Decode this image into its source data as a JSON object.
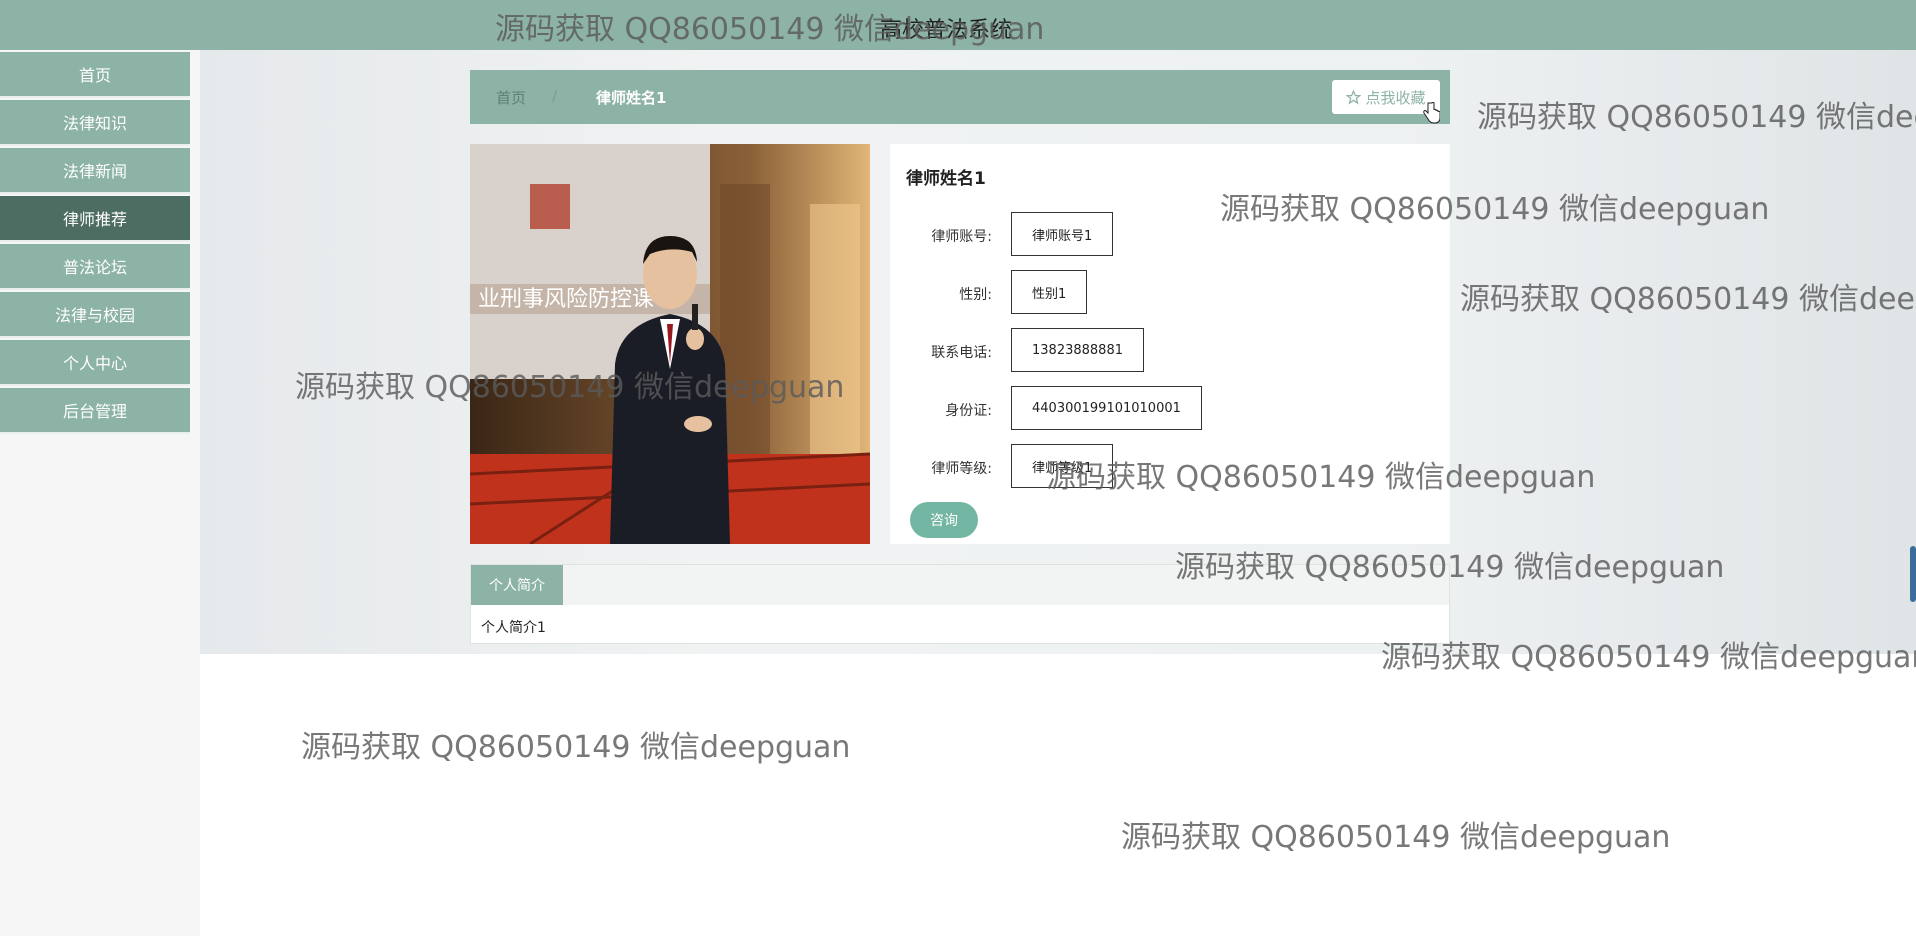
{
  "site_title": "高校普法系统",
  "nav": {
    "items": [
      {
        "label": "首页",
        "active": false
      },
      {
        "label": "法律知识",
        "active": false
      },
      {
        "label": "法律新闻",
        "active": false
      },
      {
        "label": "律师推荐",
        "active": true
      },
      {
        "label": "普法论坛",
        "active": false
      },
      {
        "label": "法律与校园",
        "active": false
      },
      {
        "label": "个人中心",
        "active": false
      },
      {
        "label": "后台管理",
        "active": false
      }
    ]
  },
  "breadcrumb": {
    "home": "首页",
    "separator": "/",
    "current": "律师姓名1"
  },
  "favorite_button": {
    "label": "点我收藏",
    "icon": "star-outline-icon"
  },
  "lawyer": {
    "name": "律师姓名1",
    "fields": [
      {
        "label": "律师账号:",
        "value": "律师账号1"
      },
      {
        "label": "性别:",
        "value": "性别1"
      },
      {
        "label": "联系电话:",
        "value": "13823888881"
      },
      {
        "label": "身份证:",
        "value": "440300199101010001"
      },
      {
        "label": "律师等级:",
        "value": "律师等级1"
      }
    ],
    "consult_label": "咨询"
  },
  "photo": {
    "banner_text": "业刑事风险防控课"
  },
  "tabs": {
    "active_label": "个人简介",
    "content": "个人简介1"
  },
  "watermark": "源码获取 QQ86050149 微信deepguan",
  "colors": {
    "primary": "#8db3a7",
    "nav_active": "#4d6d63",
    "button": "#72b5a2"
  }
}
